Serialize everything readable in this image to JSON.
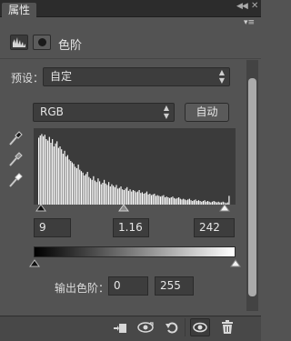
{
  "panel": {
    "tab_label": "属性"
  },
  "header": {
    "title": "色阶",
    "icons": [
      "levels-adjustment-icon",
      "layer-mask-icon"
    ]
  },
  "preset": {
    "label": "预设：",
    "value": "自定"
  },
  "channel": {
    "value": "RGB",
    "auto_label": "自动"
  },
  "eyedroppers": [
    "black-point-eyedropper-icon",
    "gray-point-eyedropper-icon",
    "white-point-eyedropper-icon"
  ],
  "input_levels": {
    "black": "9",
    "gamma": "1.16",
    "white": "242"
  },
  "output_levels": {
    "label": "输出色阶：",
    "black": "0",
    "white": "255"
  },
  "histogram": {
    "color": "#ffffff",
    "background": "#3b3b3b",
    "values": [
      0.92,
      0.95,
      0.97,
      0.94,
      0.96,
      0.9,
      0.88,
      0.93,
      0.85,
      0.9,
      0.8,
      0.84,
      0.87,
      0.78,
      0.8,
      0.76,
      0.7,
      0.74,
      0.66,
      0.68,
      0.62,
      0.6,
      0.58,
      0.56,
      0.52,
      0.5,
      0.55,
      0.48,
      0.46,
      0.44,
      0.4,
      0.42,
      0.45,
      0.38,
      0.36,
      0.34,
      0.39,
      0.33,
      0.31,
      0.36,
      0.32,
      0.28,
      0.3,
      0.34,
      0.29,
      0.27,
      0.31,
      0.25,
      0.28,
      0.26,
      0.24,
      0.27,
      0.22,
      0.23,
      0.25,
      0.21,
      0.2,
      0.22,
      0.24,
      0.19,
      0.21,
      0.18,
      0.2,
      0.19,
      0.17,
      0.18,
      0.2,
      0.16,
      0.17,
      0.15,
      0.16,
      0.18,
      0.14,
      0.15,
      0.13,
      0.14,
      0.15,
      0.12,
      0.13,
      0.12,
      0.11,
      0.12,
      0.13,
      0.1,
      0.11,
      0.1,
      0.09,
      0.1,
      0.11,
      0.09,
      0.08,
      0.09,
      0.1,
      0.08,
      0.07,
      0.08,
      0.07,
      0.06,
      0.07,
      0.08,
      0.06,
      0.05,
      0.06,
      0.07,
      0.05,
      0.06,
      0.05,
      0.04,
      0.05,
      0.06,
      0.04,
      0.05,
      0.04,
      0.03,
      0.04,
      0.05,
      0.04,
      0.03,
      0.04,
      0.03,
      0.03,
      0.04,
      0.03,
      0.02,
      0.03,
      0.12
    ]
  },
  "bottom_toolbar": [
    "clip-to-layer-icon",
    "view-previous-state-icon",
    "reset-icon",
    "toggle-visibility-icon",
    "delete-icon"
  ]
}
